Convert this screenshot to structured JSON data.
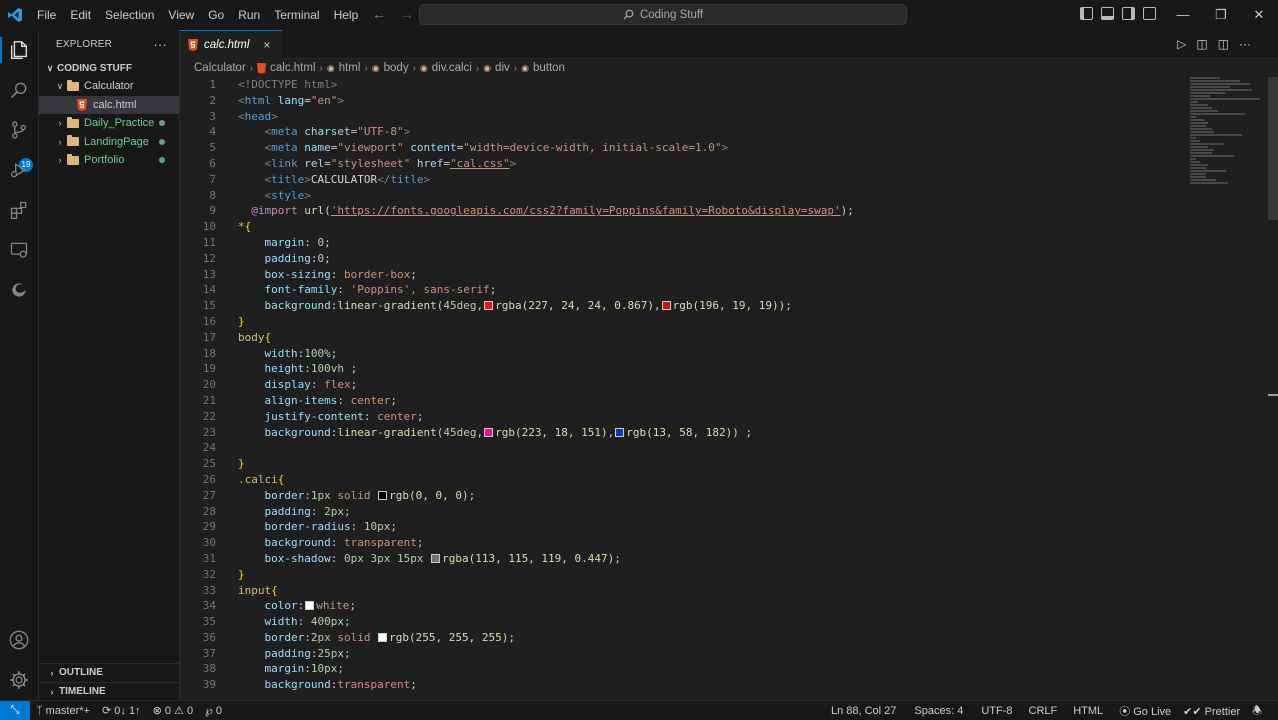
{
  "menu": [
    "File",
    "Edit",
    "Selection",
    "View",
    "Go",
    "Run",
    "Terminal",
    "Help"
  ],
  "command_center": "Coding Stuff",
  "activity_badge": "19",
  "sidebar": {
    "title": "EXPLORER",
    "more": "···",
    "root": "CODING STUFF",
    "tree": [
      {
        "label": "Calculator",
        "type": "folder",
        "expanded": true
      },
      {
        "label": "calc.html",
        "type": "file"
      },
      {
        "label": "Daily_Practice",
        "type": "folder",
        "modified": true
      },
      {
        "label": "LandingPage",
        "type": "folder",
        "modified": true
      },
      {
        "label": "Portfolio",
        "type": "folder",
        "modified": true
      }
    ],
    "outline": "OUTLINE",
    "timeline": "TIMELINE"
  },
  "tab": {
    "title": "calc.html",
    "close": "×"
  },
  "breadcrumb": [
    "Calculator",
    "calc.html",
    "html",
    "body",
    "div.calci",
    "div",
    "button"
  ],
  "colors": {
    "accent": "#0078d4",
    "swatch_red1": "#e31818",
    "swatch_red2": "#c41313",
    "swatch_pink": "#df1297",
    "swatch_blue": "#0d3ab6",
    "swatch_black": "#000000",
    "swatch_grey": "#717377",
    "swatch_white": "#ffffff"
  },
  "code": {
    "l1": "<!DOCTYPE html>",
    "l2a": "lang",
    "l2b": "\"en\"",
    "l4a": "charset",
    "l4b": "\"UTF-8\"",
    "l5a": "name",
    "l5b": "\"viewport\"",
    "l5c": "content",
    "l5d": "\"width=device-width, initial-scale=1.0\"",
    "l6a": "rel",
    "l6b": "\"stylesheet\"",
    "l6c": "href",
    "l6d": "\"cal.css\"",
    "l7": "CALCULATOR",
    "l9": "'https://fonts.googleapis.com/css2?family=Poppins&family=Roboto&display=swap'",
    "l13": "border-box",
    "l14": "'Poppins', sans-serif",
    "l15": "rgba(227, 24, 24, 0.867)",
    "l15b": "rgb(196, 19, 19)",
    "l23": "rgb(223, 18, 151)",
    "l23b": "rgb(13, 58, 182)",
    "l27": "rgb(0, 0, 0)",
    "l31": "rgba(113, 115, 119, 0.447)",
    "l36": "rgb(255, 255, 255)"
  },
  "status": {
    "branch": "master*+",
    "sync": "0↓ 1↑",
    "errors": "0",
    "warnings": "0",
    "ports": "0",
    "position": "Ln 88, Col 27",
    "spaces": "Spaces: 4",
    "encoding": "UTF-8",
    "eol": "CRLF",
    "language": "HTML",
    "golive": "Go Live",
    "prettier": "Prettier"
  }
}
